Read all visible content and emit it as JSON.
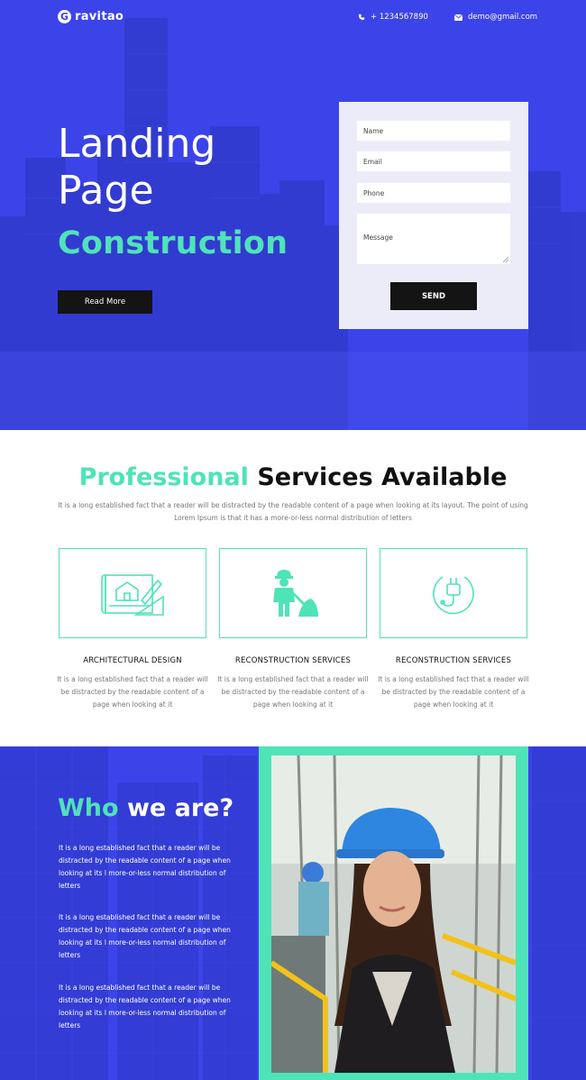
{
  "brand": {
    "logo_letter": "G",
    "name": "ravitao"
  },
  "nav": {
    "phone": "+ 1234567890",
    "email": "demo@gmail.com"
  },
  "hero": {
    "title_line1": "Landing",
    "title_line2": "Page",
    "subtitle": "Construction",
    "cta_label": "Read More"
  },
  "form": {
    "name_placeholder": "Name",
    "email_placeholder": "Email",
    "phone_placeholder": "Phone",
    "message_placeholder": "Message",
    "send_label": "SEND"
  },
  "services": {
    "title_accent": "Professional",
    "title_rest": " Services Available",
    "description": "It is a long established fact that a reader will be distracted by the readable content of a page when looking at its layout. The point of using Lorem Ipsum is that it has a more-or-less normal distribution of letters",
    "items": [
      {
        "name": "ARCHITECTURAL DESIGN",
        "icon": "blueprint-icon",
        "description": "It is a long established fact that a reader will be distracted by the readable content of a page when looking at it"
      },
      {
        "name": "RECONSTRUCTION SERVICES",
        "icon": "worker-shovel-icon",
        "description": "It is a long established fact that a reader will be distracted by the readable content of a page when looking at it"
      },
      {
        "name": "RECONSTRUCTION SERVICES",
        "icon": "power-plug-icon",
        "description": "It is a long established fact that a reader will be distracted by the readable content of a page when looking at it"
      }
    ]
  },
  "who": {
    "title_accent": "Who",
    "title_rest": " we are?",
    "paragraphs": [
      "It is a long established fact that a reader will be distracted by the readable content of a page when looking at its l more-or-less normal distribution of letters",
      "It is a long established fact that a reader will be distracted by the readable content of a page when looking at its l more-or-less normal distribution of letters",
      "It is a long established fact that a reader will be distracted by the readable content of a page when looking at its l more-or-less normal distribution of letters"
    ]
  },
  "colors": {
    "primary": "#3b44e8",
    "accent": "#4fe3b8",
    "dark": "#141414"
  }
}
